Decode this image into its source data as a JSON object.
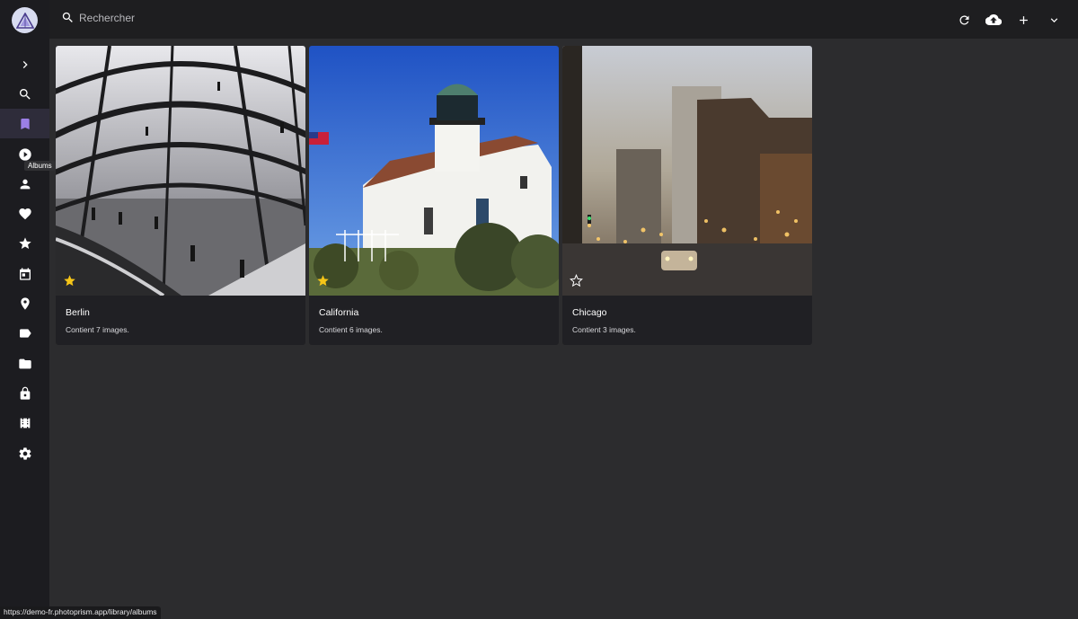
{
  "sidebar": {
    "tooltip": "Albums",
    "items": [
      {
        "icon": "chevron-right-icon",
        "name": "expand"
      },
      {
        "icon": "search-icon",
        "name": "search"
      },
      {
        "icon": "bookmark-icon",
        "name": "albums",
        "active": true
      },
      {
        "icon": "play-circle-icon",
        "name": "videos"
      },
      {
        "icon": "person-icon",
        "name": "people"
      },
      {
        "icon": "heart-icon",
        "name": "favorites"
      },
      {
        "icon": "star-icon",
        "name": "moments"
      },
      {
        "icon": "calendar-icon",
        "name": "calendar"
      },
      {
        "icon": "location-pin-icon",
        "name": "places"
      },
      {
        "icon": "label-icon",
        "name": "labels"
      },
      {
        "icon": "folder-icon",
        "name": "folders"
      },
      {
        "icon": "lock-icon",
        "name": "private"
      },
      {
        "icon": "library-icon",
        "name": "library"
      },
      {
        "icon": "gear-icon",
        "name": "settings"
      }
    ]
  },
  "search": {
    "placeholder": "Rechercher"
  },
  "toolbar": {
    "buttons": [
      "refresh-icon",
      "upload-cloud-icon",
      "plus-icon",
      "chevron-down-icon"
    ]
  },
  "albums": [
    {
      "title": "Berlin",
      "subtitle": "Contient 7 images.",
      "favorite": true
    },
    {
      "title": "California",
      "subtitle": "Contient 6 images.",
      "favorite": true
    },
    {
      "title": "Chicago",
      "subtitle": "Contient 3 images.",
      "favorite": false
    }
  ],
  "colors": {
    "accent": "#9b7fe6",
    "star": "#f5c518",
    "background": "#2c2c2e"
  },
  "status_url": "https://demo-fr.photoprism.app/library/albums"
}
